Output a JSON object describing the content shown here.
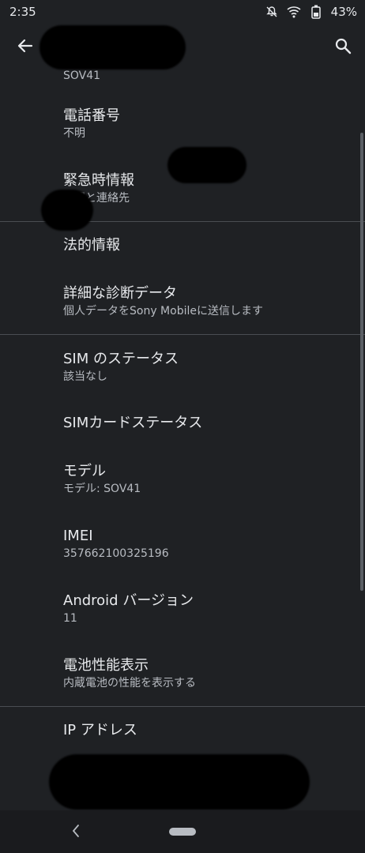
{
  "status_bar": {
    "time": "2:35",
    "battery_text": "43%",
    "icons": [
      "notification-muted-icon",
      "wifi-icon",
      "battery-icon"
    ]
  },
  "app_bar": {
    "back_icon": "arrow-left-icon",
    "search_icon": "search-icon"
  },
  "items": [
    {
      "title": "",
      "summary": "SOV41"
    },
    {
      "title": "電話番号",
      "summary": "不明"
    },
    {
      "title": "緊急時情報",
      "summary": "情報と連絡先"
    },
    {
      "title": "法的情報",
      "summary": ""
    },
    {
      "title": "詳細な診断データ",
      "summary": "個人データをSony Mobileに送信します"
    },
    {
      "title": "SIM のステータス",
      "summary": "該当なし"
    },
    {
      "title": "SIMカードステータス",
      "summary": ""
    },
    {
      "title": "モデル",
      "summary": "モデル: SOV41"
    },
    {
      "title": "IMEI",
      "summary": "357662100325196"
    },
    {
      "title": "Android バージョン",
      "summary": "11"
    },
    {
      "title": "電池性能表示",
      "summary": "内蔵電池の性能を表示する"
    },
    {
      "title": "IP アドレス",
      "summary": ""
    }
  ],
  "colors": {
    "background": "#1f2124",
    "text": "#e8eaed",
    "secondary_text": "#b8bcc2",
    "divider": "#4a4d52"
  }
}
